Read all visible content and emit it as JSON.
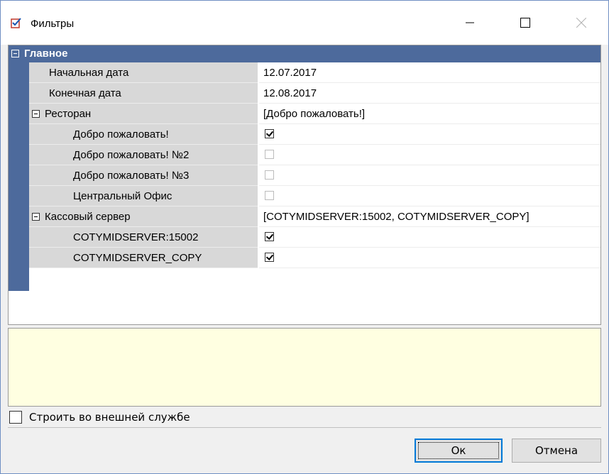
{
  "window": {
    "title": "Фильтры",
    "controls": [
      "minimize",
      "maximize",
      "close"
    ]
  },
  "grid": {
    "category": "Главное",
    "rows": [
      {
        "name": "Начальная дата",
        "value": "12.07.2017"
      },
      {
        "name": "Конечная дата",
        "value": "12.08.2017"
      },
      {
        "name": "Ресторан",
        "value": "[Добро пожаловать!]",
        "expandable": true
      },
      {
        "name": "Добро пожаловать!",
        "checked": true
      },
      {
        "name": "Добро пожаловать! №2",
        "checked": false
      },
      {
        "name": "Добро пожаловать! №3",
        "checked": false
      },
      {
        "name": "Центральный Офис",
        "checked": false
      },
      {
        "name": "Кассовый сервер",
        "value": "[COTYMIDSERVER:15002, COTYMIDSERVER_COPY]",
        "expandable": true
      },
      {
        "name": "COTYMIDSERVER:15002",
        "checked": true
      },
      {
        "name": "COTYMIDSERVER_COPY",
        "checked": true
      }
    ]
  },
  "description": "",
  "external_service": {
    "label": "Строить во внешней службе",
    "checked": false
  },
  "buttons": {
    "ok": "Ок",
    "cancel": "Отмена"
  },
  "colors": {
    "category_bg": "#4d6a9c",
    "description_bg": "#ffffe1",
    "accent": "#0078d7"
  },
  "icons": {
    "title": "checklist-icon"
  }
}
